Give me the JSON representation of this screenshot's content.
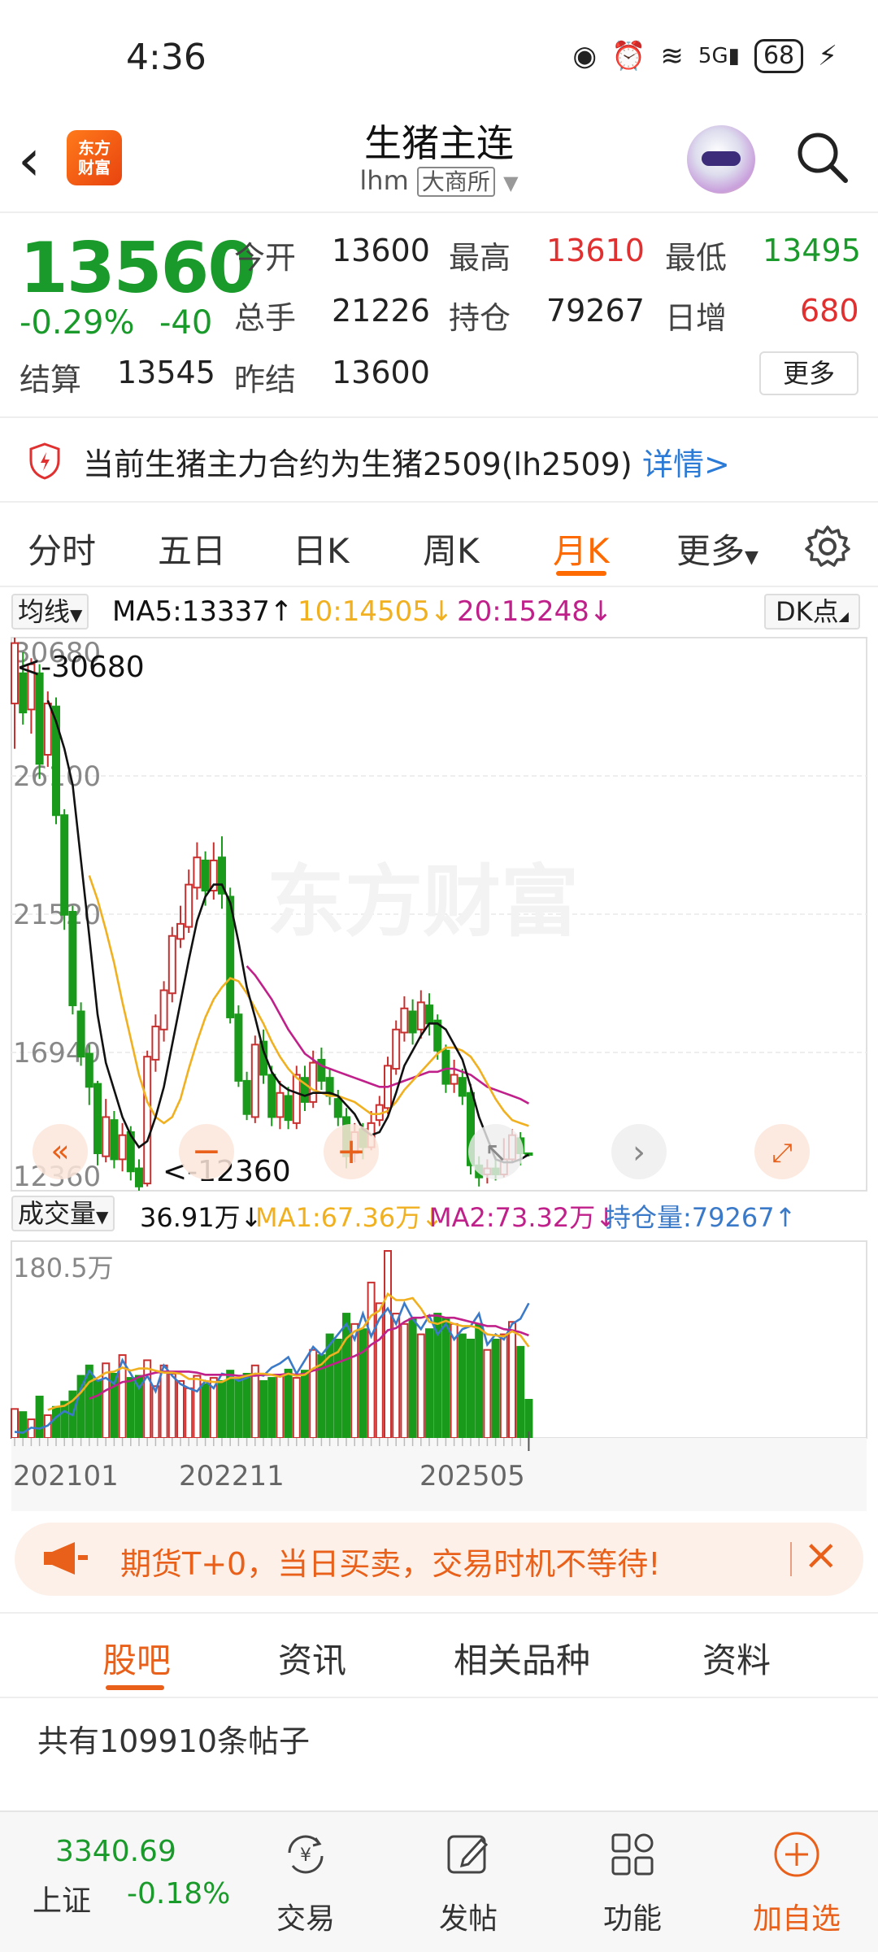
{
  "status": {
    "time": "4:36",
    "battery": "68",
    "network": "5G"
  },
  "nav": {
    "title": "生猪主连",
    "code": "lhm",
    "exchange": "大商所"
  },
  "quote": {
    "price": "13560",
    "change_pct": "-0.29%",
    "change": "-40",
    "open_label": "今开",
    "open": "13600",
    "high_label": "最高",
    "high": "13610",
    "low_label": "最低",
    "low": "13495",
    "volume_label": "总手",
    "volume": "21226",
    "oi_label": "持仓",
    "oi": "79267",
    "oi_chg_label": "日增",
    "oi_chg": "680",
    "settle_label": "结算",
    "settle": "13545",
    "prev_settle_label": "昨结",
    "prev_settle": "13600",
    "more": "更多"
  },
  "notice": {
    "text": "当前生猪主力合约为生猪2509(lh2509)",
    "link": "详情>"
  },
  "tabs": [
    "分时",
    "五日",
    "日K",
    "周K",
    "月K",
    "更多"
  ],
  "active_tab": "月K",
  "ma_bar": {
    "selector": "均线",
    "ma5": "MA5:13337↑",
    "ma10": "10:14505↓",
    "ma20": "20:15248↓",
    "dk": "DK点"
  },
  "vol_bar": {
    "selector": "成交量",
    "vol": "36.91万↓",
    "ma1": "MA1:67.36万↓",
    "ma2": "MA2:73.32万↓",
    "oi": "持仓量:79267↑"
  },
  "colors": {
    "up": "#c83030",
    "down": "#1a9a1a",
    "ma5": "#111111",
    "ma10": "#f0b020",
    "ma20": "#c0208a",
    "oi_line": "#3a7ac8",
    "accent": "#ff6a00"
  },
  "chart_data": {
    "type": "candlestick",
    "y_ticks": [
      "30680",
      "26100",
      "21520",
      "16940",
      "12360"
    ],
    "ylim": [
      12360,
      30680
    ],
    "max_marker": "<-30680",
    "min_marker": "<-12360",
    "x_ticks": [
      "202101",
      "202211",
      "202505"
    ],
    "vol_max_label": "180.5万",
    "watermark": "东方财富",
    "candles": [
      [
        28500,
        30500,
        27000,
        30680
      ],
      [
        29500,
        28200,
        27800,
        30200
      ],
      [
        28300,
        29800,
        27500,
        30000
      ],
      [
        29500,
        26500,
        26000,
        29800
      ],
      [
        26800,
        28500,
        26400,
        28900
      ],
      [
        28400,
        24800,
        24500,
        28700
      ],
      [
        24800,
        21500,
        21000,
        25000
      ],
      [
        21600,
        18500,
        18200,
        21800
      ],
      [
        18300,
        16800,
        16500,
        18600
      ],
      [
        16900,
        15800,
        15200,
        17200
      ],
      [
        15900,
        13600,
        13200,
        16000
      ],
      [
        13500,
        14800,
        13300,
        15400
      ],
      [
        14700,
        13400,
        13100,
        15000
      ],
      [
        13400,
        14200,
        13000,
        14600
      ],
      [
        14300,
        13000,
        12700,
        14500
      ],
      [
        13100,
        12500,
        12360,
        13400
      ],
      [
        12600,
        16800,
        12500,
        17000
      ],
      [
        16700,
        17800,
        16300,
        18200
      ],
      [
        17700,
        19000,
        17300,
        19300
      ],
      [
        18900,
        20800,
        18600,
        21100
      ],
      [
        20700,
        21200,
        20400,
        21800
      ],
      [
        21100,
        22500,
        20900,
        23000
      ],
      [
        22400,
        23400,
        22000,
        23900
      ],
      [
        23300,
        22300,
        21800,
        23600
      ],
      [
        22300,
        23300,
        22000,
        23900
      ],
      [
        23400,
        22200,
        21700,
        24100
      ],
      [
        22100,
        18100,
        17900,
        22400
      ],
      [
        18200,
        16000,
        15800,
        18500
      ],
      [
        16000,
        14900,
        14700,
        16300
      ],
      [
        14800,
        17200,
        14600,
        17500
      ],
      [
        17300,
        16200,
        15900,
        17700
      ],
      [
        16200,
        14800,
        14500,
        16500
      ],
      [
        14800,
        15600,
        14400,
        16000
      ],
      [
        15500,
        14700,
        14400,
        15800
      ],
      [
        14600,
        16200,
        14400,
        16500
      ],
      [
        16100,
        15300,
        15000,
        16500
      ],
      [
        15300,
        16600,
        15100,
        17000
      ],
      [
        16700,
        16000,
        15700,
        17100
      ],
      [
        16100,
        15500,
        15200,
        16400
      ],
      [
        15400,
        14800,
        14500,
        15700
      ],
      [
        14800,
        13500,
        13100,
        15100
      ],
      [
        13600,
        14300,
        13300,
        14600
      ],
      [
        14400,
        13800,
        13400,
        14600
      ],
      [
        13800,
        14600,
        13700,
        15000
      ],
      [
        14700,
        15200,
        14500,
        15500
      ],
      [
        15100,
        16500,
        14900,
        16800
      ],
      [
        16400,
        17700,
        16200,
        18000
      ],
      [
        17600,
        18400,
        17300,
        18800
      ],
      [
        18300,
        17600,
        17200,
        18700
      ],
      [
        17700,
        18600,
        17400,
        19000
      ],
      [
        18500,
        17900,
        17500,
        18900
      ],
      [
        18000,
        17000,
        16700,
        18200
      ],
      [
        17000,
        15900,
        15600,
        17200
      ],
      [
        15900,
        16200,
        15600,
        16700
      ],
      [
        16100,
        15500,
        15200,
        16400
      ],
      [
        15600,
        13200,
        12900,
        15900
      ],
      [
        13200,
        12800,
        12500,
        13500
      ],
      [
        12900,
        13100,
        12600,
        13400
      ],
      [
        13100,
        12900,
        12700,
        13500
      ],
      [
        12900,
        13400,
        12800,
        14100
      ],
      [
        13400,
        14200,
        13300,
        14400
      ],
      [
        14100,
        13600,
        13200,
        14300
      ],
      [
        13600,
        13560,
        13495,
        13610
      ]
    ],
    "ma5": [
      null,
      null,
      null,
      null,
      28600,
      27900,
      27000,
      25800,
      23300,
      20800,
      18200,
      16600,
      15700,
      14800,
      14200,
      13800,
      14000,
      14800,
      15800,
      17200,
      18600,
      20000,
      21300,
      22100,
      22500,
      22500,
      21900,
      20600,
      19100,
      18100,
      17000,
      16300,
      15900,
      15700,
      15600,
      15500,
      15600,
      15600,
      15600,
      15500,
      15200,
      14900,
      14400,
      14200,
      14300,
      14800,
      15600,
      16500,
      17000,
      17500,
      17900,
      17900,
      17700,
      17200,
      16700,
      15800,
      14800,
      14100,
      13400,
      13300,
      13300,
      13400,
      13560
    ],
    "ma10": [
      null,
      null,
      null,
      null,
      null,
      null,
      null,
      null,
      null,
      22800,
      22000,
      21000,
      19900,
      18600,
      17400,
      16200,
      15300,
      14800,
      14600,
      14800,
      15400,
      16400,
      17300,
      18100,
      18700,
      19100,
      19400,
      19300,
      18900,
      18400,
      17900,
      17300,
      16800,
      16400,
      16100,
      15900,
      15700,
      15600,
      15500,
      15500,
      15400,
      15300,
      15100,
      14900,
      14900,
      15000,
      15300,
      15700,
      16000,
      16300,
      16600,
      16900,
      17100,
      17100,
      17000,
      16800,
      16400,
      15900,
      15400,
      15000,
      14700,
      14600,
      14505
    ],
    "ma20": [
      null,
      null,
      null,
      null,
      null,
      null,
      null,
      null,
      null,
      null,
      null,
      null,
      null,
      null,
      null,
      null,
      null,
      null,
      null,
      null,
      null,
      null,
      null,
      null,
      null,
      null,
      null,
      null,
      19800,
      19500,
      19100,
      18700,
      18200,
      17700,
      17300,
      16900,
      16700,
      16500,
      16400,
      16300,
      16200,
      16100,
      16000,
      15900,
      15800,
      15800,
      15900,
      16000,
      16100,
      16200,
      16300,
      16300,
      16400,
      16400,
      16300,
      16200,
      16000,
      15800,
      15700,
      15600,
      15500,
      15400,
      15248
    ],
    "volume_wan": [
      28,
      25,
      18,
      40,
      22,
      30,
      35,
      45,
      60,
      70,
      55,
      72,
      62,
      80,
      58,
      60,
      75,
      50,
      70,
      62,
      55,
      48,
      60,
      52,
      58,
      55,
      65,
      58,
      62,
      70,
      55,
      58,
      60,
      66,
      58,
      65,
      85,
      80,
      100,
      95,
      120,
      110,
      105,
      150,
      130,
      180.5,
      120,
      110,
      115,
      100,
      105,
      120,
      115,
      110,
      100,
      95,
      110,
      85,
      95,
      100,
      112,
      88,
      36.91
    ],
    "oi_wan": [
      6,
      5,
      10,
      9,
      12,
      20,
      26,
      22,
      48,
      65,
      55,
      58,
      52,
      75,
      62,
      48,
      60,
      45,
      70,
      60,
      52,
      48,
      45,
      55,
      48,
      62,
      60,
      55,
      58,
      62,
      60,
      68,
      72,
      78,
      62,
      75,
      88,
      80,
      90,
      100,
      110,
      95,
      120,
      98,
      115,
      125,
      110,
      130,
      115,
      105,
      118,
      100,
      110,
      95,
      105,
      108,
      120,
      90,
      100,
      95,
      110,
      115,
      130
    ],
    "vol_ma1": [
      null,
      null,
      null,
      null,
      27,
      30,
      31,
      36,
      44,
      54,
      58,
      63,
      64,
      68,
      65,
      67,
      67,
      65,
      63,
      63,
      62,
      57,
      57,
      55,
      54,
      54,
      58,
      58,
      60,
      62,
      62,
      61,
      59,
      62,
      60,
      61,
      67,
      71,
      79,
      83,
      96,
      103,
      106,
      118,
      123,
      139,
      133,
      133,
      135,
      125,
      112,
      110,
      113,
      110,
      108,
      108,
      106,
      100,
      99,
      98,
      103,
      99,
      88
    ],
    "vol_ma2": [
      null,
      null,
      null,
      null,
      null,
      null,
      null,
      null,
      null,
      38,
      41,
      46,
      50,
      54,
      55,
      59,
      61,
      63,
      64,
      64,
      64,
      64,
      63,
      61,
      61,
      61,
      61,
      60,
      60,
      60,
      61,
      61,
      61,
      62,
      61,
      62,
      65,
      67,
      70,
      73,
      76,
      79,
      83,
      90,
      95,
      104,
      106,
      112,
      116,
      116,
      118,
      118,
      116,
      116,
      114,
      112,
      110,
      108,
      108,
      105,
      104,
      102,
      99
    ]
  },
  "promo": {
    "text": "期货T+0，当日买卖，交易时机不等待!"
  },
  "bottom_tabs": [
    "股吧",
    "资讯",
    "相关品种",
    "资料"
  ],
  "posts": "共有109910条帖子",
  "bottom_bar": {
    "index_value": "3340.69",
    "index_name": "上证",
    "index_change": "-0.18%",
    "trade": "交易",
    "post": "发帖",
    "func": "功能",
    "add": "加自选"
  }
}
